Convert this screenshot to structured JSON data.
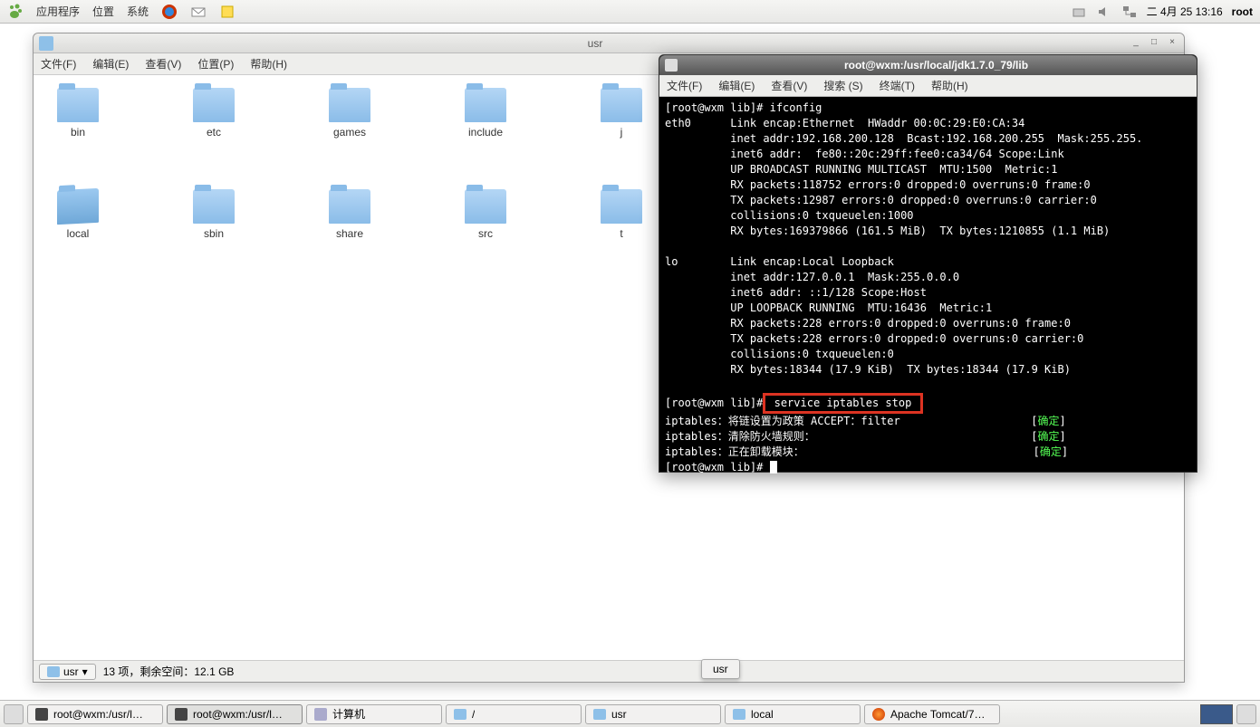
{
  "top_panel": {
    "apps": "应用程序",
    "places": "位置",
    "system": "系统",
    "clock": "二  4月 25 13:16",
    "user": "root"
  },
  "fm": {
    "title": "usr",
    "menus": {
      "file": "文件(F)",
      "edit": "编辑(E)",
      "view": "查看(V)",
      "places": "位置(P)",
      "help": "帮助(H)"
    },
    "folders": [
      "bin",
      "etc",
      "games",
      "include",
      "j",
      "local",
      "sbin",
      "share",
      "src",
      "t"
    ],
    "status_path": "usr",
    "status_text": "13 项，剩余空间：12.1 GB"
  },
  "term": {
    "title": "root@wxm:/usr/local/jdk1.7.0_79/lib",
    "menus": {
      "file": "文件(F)",
      "edit": "编辑(E)",
      "view": "查看(V)",
      "search": "搜索 (S)",
      "terminal": "终端(T)",
      "help": "帮助(H)"
    },
    "prompt1": "[root@wxm lib]# ifconfig",
    "eth0_l1": "eth0      Link encap:Ethernet  HWaddr 00:0C:29:E0:CA:34",
    "eth0_l2": "          inet addr:192.168.200.128  Bcast:192.168.200.255  Mask:255.255.",
    "eth0_l3": "          inet6 addr:  fe80::20c:29ff:fee0:ca34/64 Scope:Link",
    "eth0_l4": "          UP BROADCAST RUNNING MULTICAST  MTU:1500  Metric:1",
    "eth0_l5": "          RX packets:118752 errors:0 dropped:0 overruns:0 frame:0",
    "eth0_l6": "          TX packets:12987 errors:0 dropped:0 overruns:0 carrier:0",
    "eth0_l7": "          collisions:0 txqueuelen:1000",
    "eth0_l8": "          RX bytes:169379866 (161.5 MiB)  TX bytes:1210855 (1.1 MiB)",
    "lo_l1": "lo        Link encap:Local Loopback",
    "lo_l2": "          inet addr:127.0.0.1  Mask:255.0.0.0",
    "lo_l3": "          inet6 addr: ::1/128 Scope:Host",
    "lo_l4": "          UP LOOPBACK RUNNING  MTU:16436  Metric:1",
    "lo_l5": "          RX packets:228 errors:0 dropped:0 overruns:0 frame:0",
    "lo_l6": "          TX packets:228 errors:0 dropped:0 overruns:0 carrier:0",
    "lo_l7": "          collisions:0 txqueuelen:0",
    "lo_l8": "          RX bytes:18344 (17.9 KiB)  TX bytes:18344 (17.9 KiB)",
    "prompt2_pre": "[root@wxm lib]#",
    "cmd2": " service iptables stop ",
    "ipt1_pre": "iptables：将链设置为政策 ACCEPT：filter                    [",
    "ipt2_pre": "iptables：清除防火墙规则：                                 [",
    "ipt3_pre": "iptables：正在卸载模块：                                   [",
    "ok": "确定",
    "ok_suf": "]",
    "prompt3": "[root@wxm lib]# "
  },
  "overlay": {
    "usr": "usr"
  },
  "taskbar": {
    "items": [
      {
        "label": "root@wxm:/usr/l…",
        "type": "term"
      },
      {
        "label": "root@wxm:/usr/l…",
        "type": "term",
        "active": true
      },
      {
        "label": "计算机",
        "type": "folder"
      },
      {
        "label": "/",
        "type": "folder"
      },
      {
        "label": "usr",
        "type": "folder"
      },
      {
        "label": "local",
        "type": "folder"
      },
      {
        "label": "Apache Tomcat/7…",
        "type": "firefox"
      }
    ]
  }
}
